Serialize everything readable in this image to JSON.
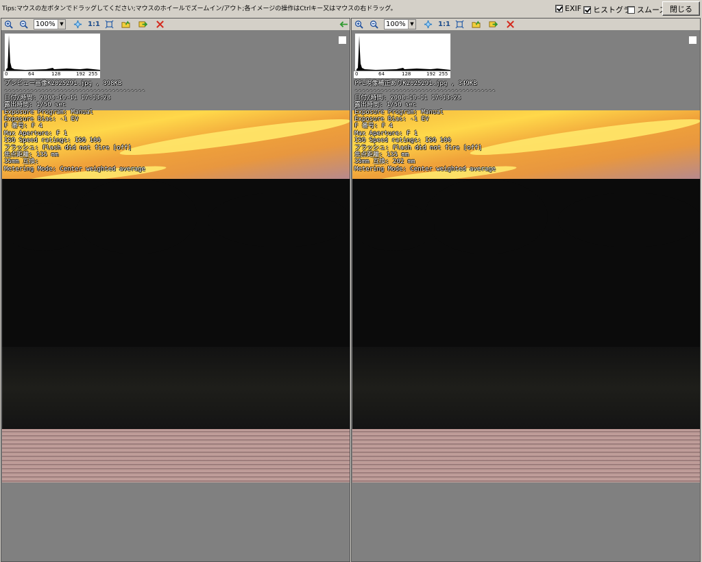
{
  "topbar": {
    "tips": "Tips:マウスの左ボタンでドラッグしてください;マウスのホイールでズームイン/アウト;各イメージの操作はCtrlキー又はマウスの右ドラッグ。",
    "exif_label": "EXIF",
    "exif_checked": true,
    "hist_label": "ヒストグラ",
    "hist_checked": true,
    "smooth_label": "スムーズ",
    "smooth_checked": false,
    "close_label": "閉じる"
  },
  "toolbar": {
    "zoom_value": "100%",
    "one_to_one": "1:1"
  },
  "histogram": {
    "ticks": [
      "0",
      "64",
      "128",
      "192",
      "255"
    ]
  },
  "left": {
    "filename": "プレビュー画像K2025291.jpg , 398KB",
    "separator": "--------------------------------------",
    "date": "日付/時間: 2008-10-11 17:13:28",
    "exposure": "露出時間: 1/50 sec",
    "program": "Exposure Program: Manual",
    "bias": "Exposure Bias: -1 EV",
    "fnumber": "F 番号: F 4",
    "aperture": "Max Aperture: F 1",
    "iso": "ISO Speed ratings: ISO 100",
    "flash": "フラッシュ: Flash did not fire [off]",
    "focal": "焦点距離: 135 mm",
    "focal35": "35mm 互換:",
    "metering": "Metering Mode: Center weighted average"
  },
  "right": {
    "filename": "PPL現像補正ありK2025291.jpg , 349KB",
    "separator": "--------------------------------------",
    "date": "日付/時間: 2008-10-11 17:13:28",
    "exposure": "露出時間: 1/50 sec",
    "program": "Exposure Program: Manual",
    "bias": "Exposure Bias: -1 EV",
    "fnumber": "F 番号: F 4",
    "aperture": "Max Aperture: F 1",
    "iso": "ISO Speed ratings: ISO 100",
    "flash": "フラッシュ: Flash did not fire [off]",
    "focal": "焦点距離: 135 mm",
    "focal35": "35mm 互換: 202 mm",
    "metering": "Metering Mode: Center weighted average"
  },
  "icons": [
    "zoom-in-icon",
    "zoom-out-icon",
    "fit-icon",
    "actual-size-icon",
    "fullscreen-icon",
    "open-folder-icon",
    "next-arrow-icon",
    "close-x-icon",
    "back-arrow-icon"
  ]
}
